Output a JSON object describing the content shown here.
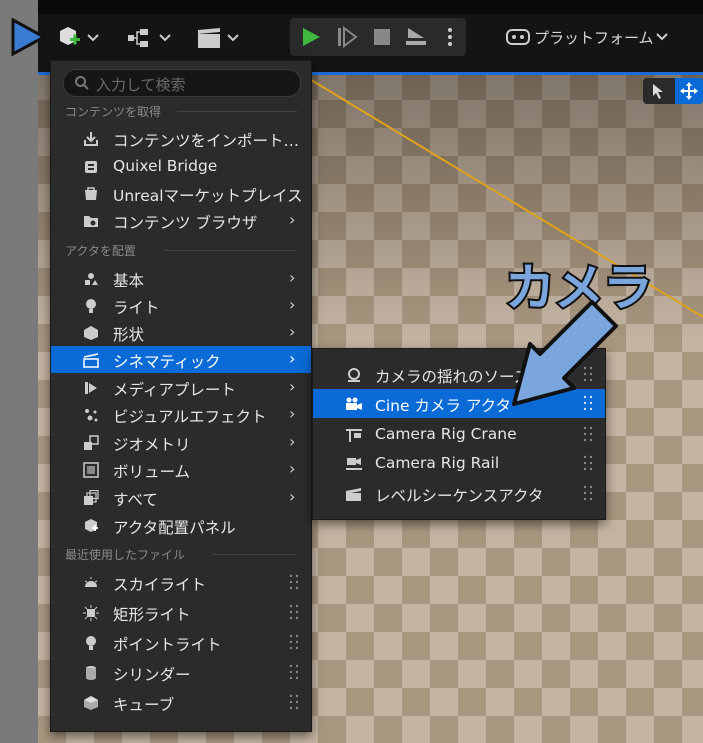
{
  "toolbar": {
    "platform_label": "プラットフォーム"
  },
  "search": {
    "placeholder": "入力して検索"
  },
  "sections": {
    "get_content": "コンテンツを取得",
    "place_actor": "アクタを配置",
    "recent": "最近使用したファイル"
  },
  "get_content_items": [
    {
      "label": "コンテンツをインポート…",
      "icon": "import-icon"
    },
    {
      "label": "Quixel Bridge",
      "icon": "quixel-bridge-icon"
    },
    {
      "label": "Unrealマーケットプレイス",
      "icon": "marketplace-icon"
    },
    {
      "label": "コンテンツ ブラウザ",
      "icon": "content-browser-icon"
    }
  ],
  "place_items": [
    {
      "label": "基本",
      "icon": "basic-icon"
    },
    {
      "label": "ライト",
      "icon": "light-icon"
    },
    {
      "label": "形状",
      "icon": "shape-icon"
    },
    {
      "label": "シネマティック",
      "icon": "cinematic-icon"
    },
    {
      "label": "メディアプレート",
      "icon": "media-plate-icon"
    },
    {
      "label": "ビジュアルエフェクト",
      "icon": "visual-effect-icon"
    },
    {
      "label": "ジオメトリ",
      "icon": "geometry-icon"
    },
    {
      "label": "ボリューム",
      "icon": "volume-icon"
    },
    {
      "label": "すべて",
      "icon": "all-icon"
    },
    {
      "label": "アクタ配置パネル",
      "icon": "place-actors-panel-icon"
    }
  ],
  "recent_items": [
    {
      "label": "スカイライト",
      "icon": "sky-light-icon"
    },
    {
      "label": "矩形ライト",
      "icon": "rect-light-icon"
    },
    {
      "label": "ポイントライト",
      "icon": "point-light-icon"
    },
    {
      "label": "シリンダー",
      "icon": "cylinder-icon"
    },
    {
      "label": "キューブ",
      "icon": "cube-icon"
    }
  ],
  "cinematic_submenu": [
    {
      "label": "カメラの揺れのソース",
      "icon": "camera-shake-icon"
    },
    {
      "label": "Cine カメラ アクタ",
      "icon": "cine-camera-icon"
    },
    {
      "label": "Camera Rig Crane",
      "icon": "camera-rig-crane-icon"
    },
    {
      "label": "Camera Rig Rail",
      "icon": "camera-rig-rail-icon"
    },
    {
      "label": "レベルシーケンスアクタ",
      "icon": "level-sequence-icon"
    }
  ],
  "annotation": {
    "label": "カメラ"
  },
  "colors": {
    "accent": "#0a6bd6",
    "menu_bg": "#2b2b2b",
    "callout": "#7aa6dd",
    "play_green": "#3fb83f"
  }
}
